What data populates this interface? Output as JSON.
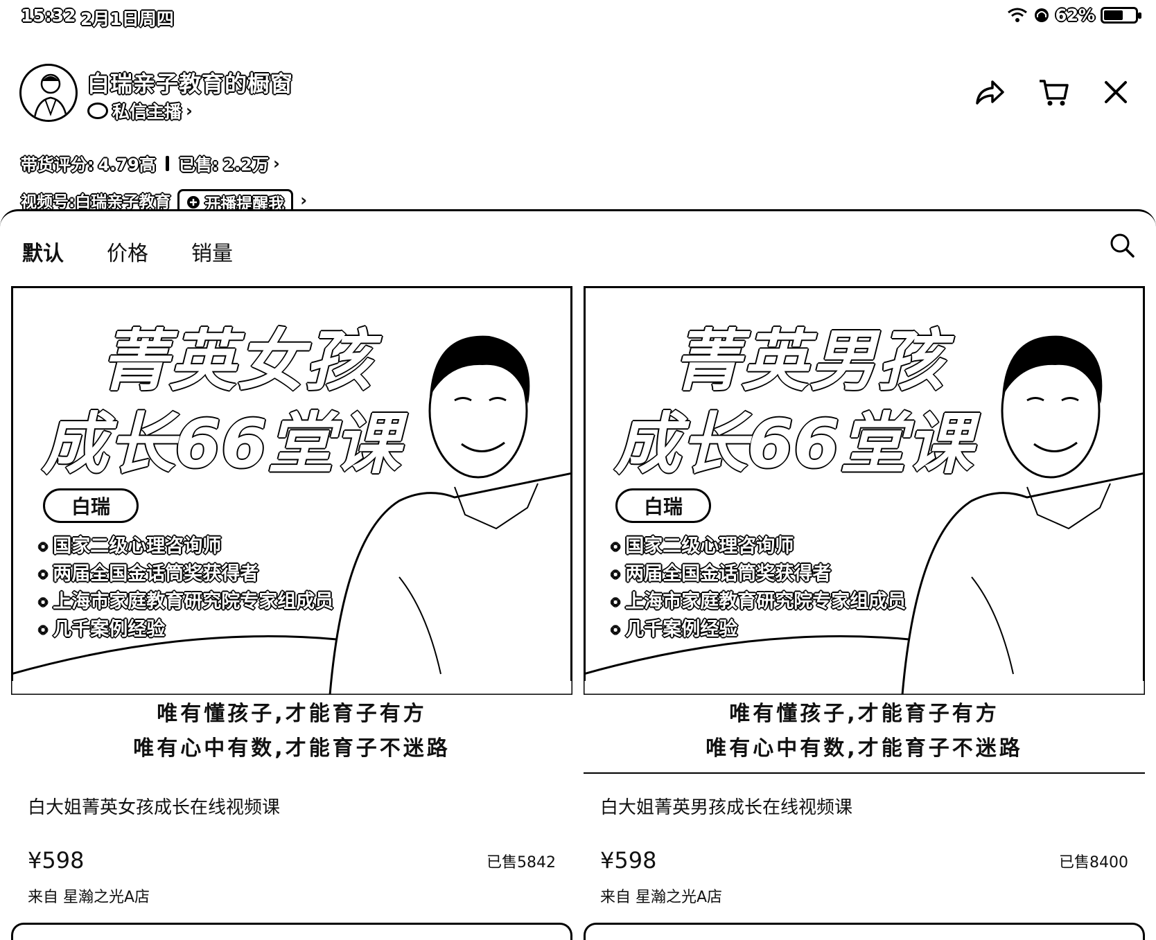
{
  "status_bar": {
    "time": "15:32",
    "date": "2月1日周四",
    "battery": "62%",
    "battery_level": 0.62,
    "icons": [
      "wifi-icon",
      "headphones-icon",
      "battery-icon"
    ]
  },
  "shop": {
    "title": "白瑞亲子教育的橱窗",
    "dm_label": "私信主播",
    "rating_label": "带货评分:",
    "rating_value": "4.79高",
    "sold_label": "已售:",
    "sold_value": "2.2万",
    "channel_label": "视频号:",
    "channel_name": "白瑞亲子教育",
    "remind_label": "开播提醒我"
  },
  "sort_tabs": [
    "默认",
    "价格",
    "销量"
  ],
  "products": [
    {
      "poster_title_1": "菁英女孩",
      "poster_title_2": "成长66堂课",
      "poster_name": "白瑞",
      "credentials": [
        "国家二级心理咨询师",
        "两届全国金话筒奖获得者",
        "上海市家庭教育研究院专家组成员",
        "几千案例经验"
      ],
      "slogan_1": "唯有懂孩子,才能育子有方",
      "slogan_2": "唯有心中有数,才能育子不迷路",
      "name": "白大姐菁英女孩成长在线视频课",
      "price": "¥598",
      "sold": "已售5842",
      "store": "来自 星瀚之光A店"
    },
    {
      "poster_title_1": "菁英男孩",
      "poster_title_2": "成长66堂课",
      "poster_name": "白瑞",
      "credentials": [
        "国家二级心理咨询师",
        "两届全国金话筒奖获得者",
        "上海市家庭教育研究院专家组成员",
        "几千案例经验"
      ],
      "slogan_1": "唯有懂孩子,才能育子有方",
      "slogan_2": "唯有心中有数,才能育子不迷路",
      "name": "白大姐菁英男孩成长在线视频课",
      "price": "¥598",
      "sold": "已售8400",
      "store": "来自 星瀚之光A店"
    }
  ]
}
